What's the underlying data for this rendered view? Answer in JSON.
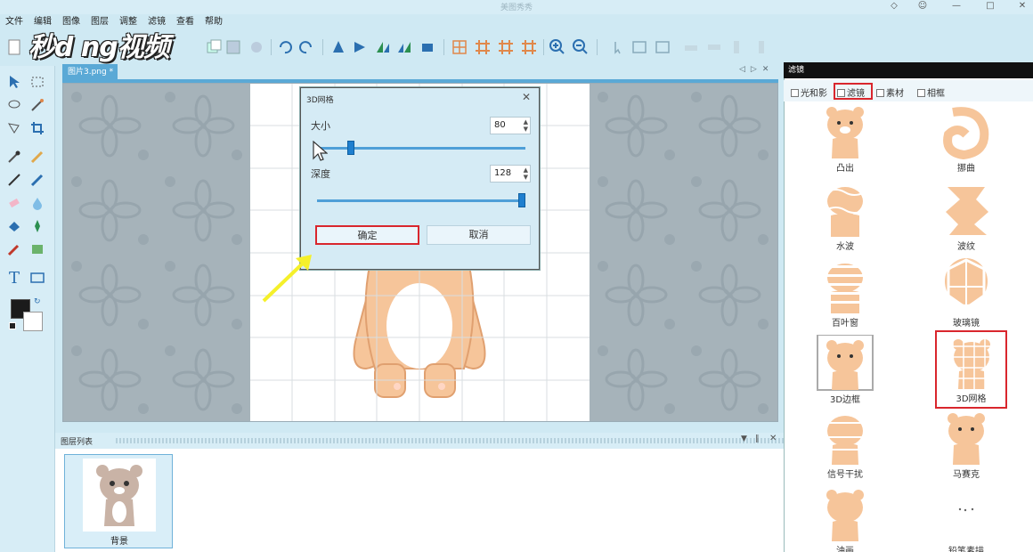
{
  "window": {
    "title": "美图秀秀"
  },
  "menu": [
    "文件",
    "编辑",
    "图像",
    "图层",
    "调整",
    "滤镜",
    "查看",
    "帮助"
  ],
  "watermark": "秒d ng视频",
  "doc_tab": {
    "label": "图片3.png *"
  },
  "dialog": {
    "title": "3D网格",
    "size_label": "大小",
    "size_value": "80",
    "depth_label": "深度",
    "depth_value": "128",
    "ok_label": "确定",
    "cancel_label": "取消",
    "size_level": 0.15,
    "depth_level": 1.0
  },
  "layers": {
    "header": "图层列表",
    "items": [
      {
        "name": "背景"
      }
    ]
  },
  "right_panel": {
    "header": "滤镜",
    "tabs": [
      "光和影",
      "滤镜",
      "素材",
      "相框"
    ],
    "filters": [
      "凸出",
      "挪曲",
      "水波",
      "波纹",
      "百叶窗",
      "玻璃镜",
      "3D边框",
      "3D网格",
      "信号干扰",
      "马赛克",
      "油画",
      "铅笔素描"
    ]
  },
  "colors": {
    "accent": "#5aa9d6",
    "highlight": "#d9262d",
    "arrow": "#f5f02a",
    "bear": "#f6c59a"
  }
}
